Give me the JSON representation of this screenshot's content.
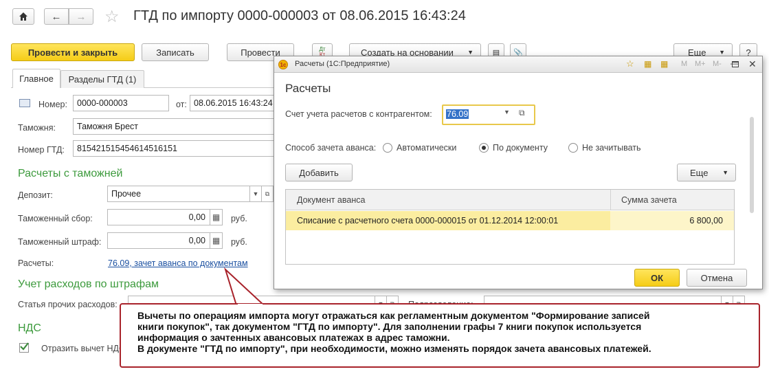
{
  "header": {
    "title": "ГТД по импорту 0000-000003 от 08.06.2015 16:43:24",
    "home_icon": "home-icon",
    "back_icon": "arrow-left-icon",
    "forward_icon": "arrow-right-icon",
    "star_icon": "star-icon"
  },
  "toolbar": {
    "post_close": "Провести и закрыть",
    "save": "Записать",
    "post": "Провести",
    "dt_kt": "Дт\nКт",
    "create_based": "Создать на основании",
    "more": "Еще",
    "help": "?"
  },
  "tabs": [
    {
      "label": "Главное"
    },
    {
      "label": "Разделы ГТД (1)"
    }
  ],
  "form": {
    "number_label": "Номер:",
    "number_value": "0000-000003",
    "date_label": "от:",
    "date_value": "08.06.2015 16:43:24",
    "customs_label": "Таможня:",
    "customs_value": "Таможня Брест",
    "gtd_label": "Номер ГТД:",
    "gtd_value": "815421515454614516151",
    "section_settlements": "Расчеты с таможней",
    "deposit_label": "Депозит:",
    "deposit_value": "Прочее",
    "fee_label": "Таможенный сбор:",
    "fee_value": "0,00",
    "fee_unit": "руб.",
    "fine_label": "Таможенный штраф:",
    "fine_value": "0,00",
    "fine_unit": "руб.",
    "settlements_label": "Расчеты:",
    "settlements_link": "76.09, зачет аванса по документам",
    "section_expenses": "Учет расходов по штрафам",
    "other_expenses_label": "Статья прочих расходов:",
    "subdivision_label": "Подразделение:",
    "section_vat": "НДС",
    "vat_checkbox_label": "Отразить вычет НДС"
  },
  "dialog": {
    "window_title": "Расчеты (1С:Предприятие)",
    "heading": "Расчеты",
    "account_label": "Счет учета расчетов с контрагентом:",
    "account_value": "76.09",
    "advance_label": "Способ зачета аванса:",
    "radio_auto": "Автоматически",
    "radio_doc": "По документу",
    "radio_none": "Не зачитывать",
    "add": "Добавить",
    "more": "Еще",
    "col_doc": "Документ аванса",
    "col_sum": "Сумма зачета",
    "rows": [
      {
        "doc": "Списание с расчетного счета 0000-000015 от 01.12.2014 12:00:01",
        "sum": "6 800,00"
      }
    ],
    "ok": "ОК",
    "cancel": "Отмена",
    "tb_m": "M",
    "tb_mplus": "M+",
    "tb_mminus": "M-"
  },
  "callout": {
    "line1": "Вычеты по операциям импорта могут отражаться как регламентным документом \"Формирование записей",
    "line2": "книги покупок\", так документом \"ГТД по импорту\". Для заполнении графы 7 книги покупок используется",
    "line3": "информация о зачтенных авансовых платежах в адрес таможни.",
    "line4": "В документе \"ГТД по импорту\", при необходимости, можно изменять порядок зачета авансовых платежей."
  },
  "colors": {
    "primary": "#f5cd17",
    "section": "#3c9a3c",
    "link": "#1a4fa0",
    "selected_row": "#fbeda0",
    "callout_border": "#a8222a"
  }
}
